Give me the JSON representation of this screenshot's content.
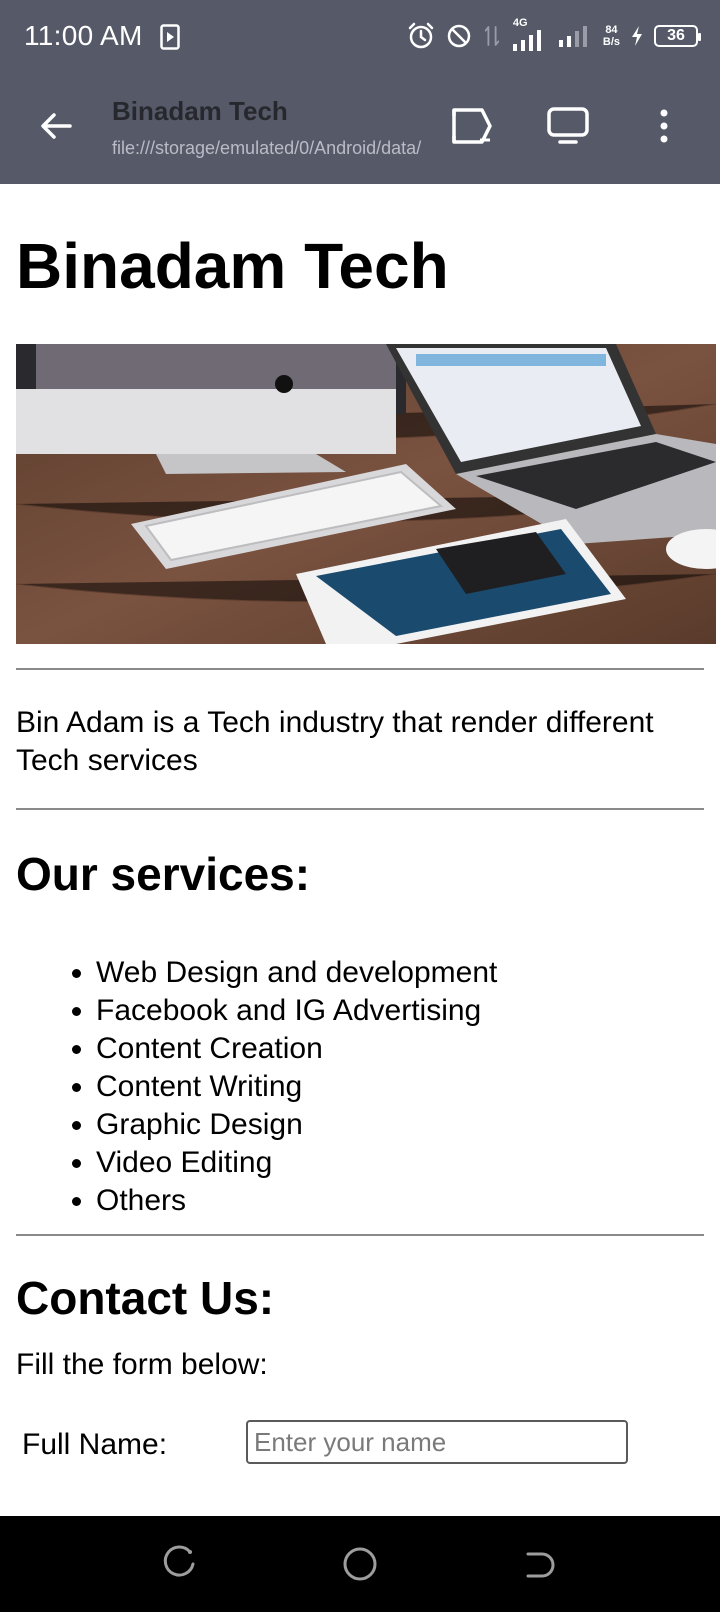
{
  "status_bar": {
    "time": "11:00 AM",
    "network_type": "4G",
    "speed_value": "84",
    "speed_unit": "B/s",
    "battery": "36",
    "icons": [
      "screen-record-icon",
      "alarm-icon",
      "do-not-disturb-icon",
      "data-transfer-icon",
      "signal-4g-icon",
      "signal-icon",
      "charging-icon",
      "battery-icon"
    ]
  },
  "toolbar": {
    "title": "Binadam Tech",
    "url": "file:///storage/emulated/0/Android/data/",
    "icons": [
      "back-arrow-icon",
      "cast-icon",
      "desktop-icon",
      "more-vert-icon"
    ]
  },
  "page": {
    "title": "Binadam Tech",
    "hero_image": "desk-with-computers-image",
    "intro": "Bin Adam is a Tech industry that render different Tech services",
    "services_heading": "Our services:",
    "services": [
      "Web Design and development",
      "Facebook and IG Advertising",
      "Content Creation",
      "Content Writing",
      "Graphic Design",
      "Video Editing",
      "Others"
    ],
    "contact_heading": "Contact Us:",
    "form_intro": "Fill the form below:",
    "full_name_label": "Full Name:",
    "full_name_placeholder": "Enter your name"
  },
  "nav_bar": {
    "icons": [
      "recent-apps-icon",
      "home-icon",
      "back-icon"
    ]
  },
  "colors": {
    "chrome": "#565a68",
    "nav": "#000000",
    "page_bg": "#ffffff",
    "rule": "#8a8a8a"
  }
}
